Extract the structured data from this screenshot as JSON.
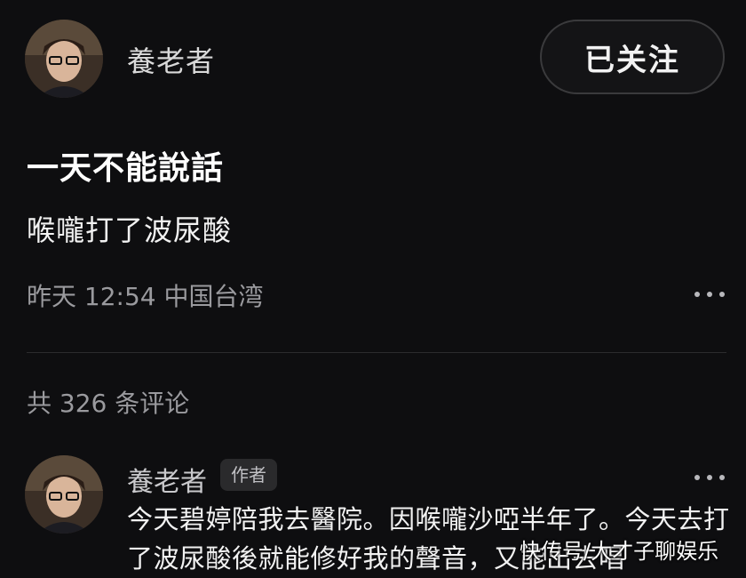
{
  "post": {
    "author_name": "養老者",
    "follow_label": "已关注",
    "title": "一天不能說話",
    "body": "喉嚨打了波尿酸",
    "meta": "昨天 12:54 中国台湾"
  },
  "comments_section": {
    "count_label": "共 326 条评论",
    "items": [
      {
        "author_name": "養老者",
        "badge": "作者",
        "text": "今天碧婷陪我去醫院。因喉嚨沙啞半年了。今天去打了波尿酸後就能修好我的聲音，又能出去唱"
      }
    ]
  },
  "watermark": "快传号/大才子聊娱乐",
  "icons": {
    "more": "more-horizontal-icon",
    "avatar": "user-avatar"
  },
  "colors": {
    "background": "#0e0e10",
    "text_primary": "#f2f2f2",
    "text_secondary": "#9a9a9e"
  }
}
